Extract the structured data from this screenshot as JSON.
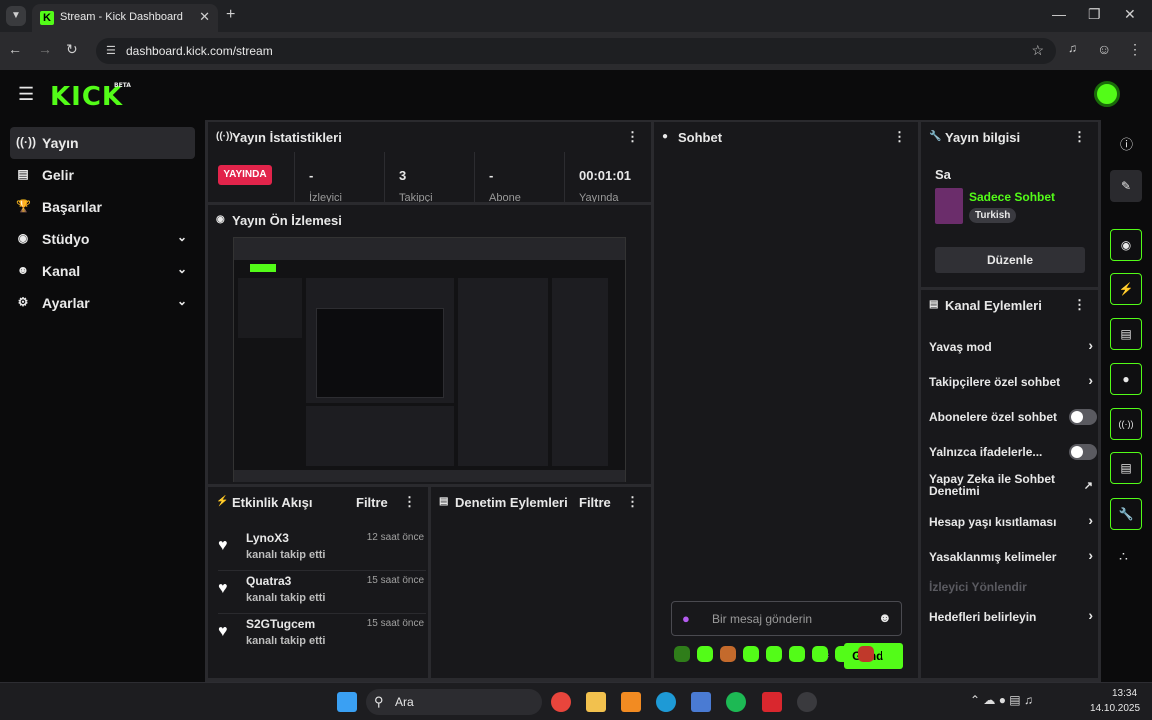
{
  "browser": {
    "tab_title": "Stream - Kick Dashboard",
    "url": "dashboard.kick.com/stream"
  },
  "logo": {
    "text": "KICK",
    "badge": "BETA"
  },
  "sidebar": {
    "items": [
      {
        "label": "Yayın",
        "icon": "broadcast-icon",
        "active": true
      },
      {
        "label": "Gelir",
        "icon": "bar-chart-icon"
      },
      {
        "label": "Başarılar",
        "icon": "trophy-icon"
      },
      {
        "label": "Stüdyo",
        "icon": "camera-icon",
        "expandable": true
      },
      {
        "label": "Kanal",
        "icon": "users-icon",
        "expandable": true
      },
      {
        "label": "Ayarlar",
        "icon": "gear-icon",
        "expandable": true
      }
    ]
  },
  "stats": {
    "title": "Yayın İstatistikleri",
    "live_badge": "YAYINDA",
    "items": [
      {
        "value": "-",
        "label": "İzleyici"
      },
      {
        "value": "3",
        "label": "Takipçi"
      },
      {
        "value": "-",
        "label": "Abone"
      },
      {
        "value": "00:01:01",
        "label": "Yayında"
      }
    ]
  },
  "preview": {
    "title": "Yayın Ön İzlemesi"
  },
  "activity": {
    "title": "Etkinlik Akışı",
    "filter": "Filtre",
    "items": [
      {
        "name": "LynoX3",
        "action": "kanalı takip etti",
        "time": "12 saat önce"
      },
      {
        "name": "Quatra3",
        "action": "kanalı takip etti",
        "time": "15 saat önce"
      },
      {
        "name": "S2GTugcem",
        "action": "kanalı takip etti",
        "time": "15 saat önce"
      }
    ]
  },
  "moderation": {
    "title": "Denetim Eylemleri",
    "filter": "Filtre"
  },
  "chat": {
    "title": "Sohbet",
    "placeholder": "Bir mesaj gönderin",
    "send": "Gönder"
  },
  "stream_info": {
    "title": "Yayın bilgisi",
    "stream_title": "Sa",
    "category": "Sadece Sohbet",
    "tag": "Turkish",
    "edit": "Düzenle"
  },
  "channel_actions": {
    "title": "Kanal Eylemleri",
    "items": [
      {
        "label": "Yavaş mod",
        "control": "arrow"
      },
      {
        "label": "Takipçilere özel sohbet",
        "control": "arrow"
      },
      {
        "label": "Abonelere özel sohbet",
        "control": "toggle"
      },
      {
        "label": "Yalnızca ifadelerle...",
        "control": "toggle"
      },
      {
        "label": "Yapay Zeka ile Sohbet Denetimi",
        "control": "external"
      },
      {
        "label": "Hesap yaşı kısıtlaması",
        "control": "arrow"
      },
      {
        "label": "Yasaklanmış kelimeler",
        "control": "arrow"
      },
      {
        "label": "İzleyici Yönlendir",
        "control": "disabled"
      },
      {
        "label": "Hedefleri belirleyin",
        "control": "arrow"
      }
    ]
  },
  "taskbar": {
    "search": "Ara",
    "time": "13:34",
    "date": "14.10.2025"
  },
  "colors": {
    "accent": "#53fc18",
    "live": "#e2244b",
    "panel": "#18181b"
  }
}
